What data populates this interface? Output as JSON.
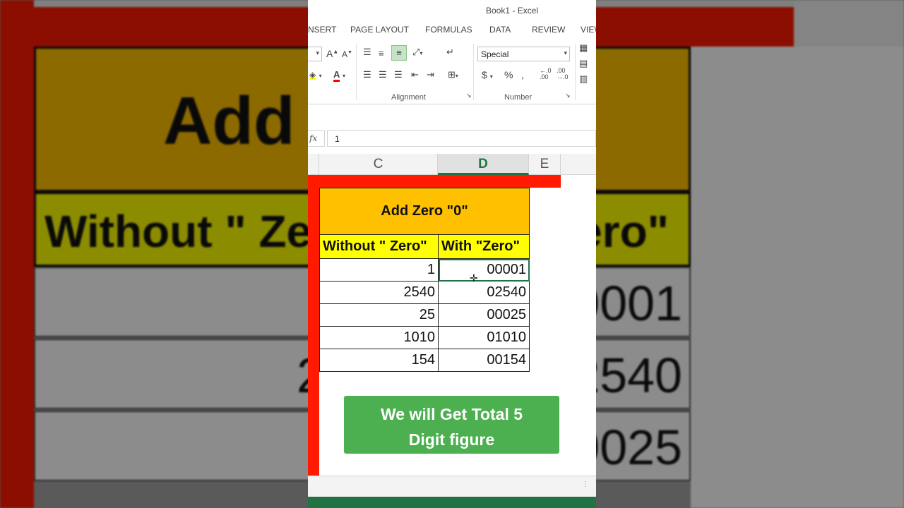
{
  "window": {
    "title": "Book1 - Excel"
  },
  "tabs": [
    "NSERT",
    "PAGE LAYOUT",
    "FORMULAS",
    "DATA",
    "REVIEW",
    "VIEW"
  ],
  "ribbon": {
    "groups": {
      "alignment": "Alignment",
      "number": "Number"
    },
    "number_format": "Special",
    "currency_symbol": "$",
    "percent_symbol": "%",
    "font_grow": "A",
    "font_shrink": "A",
    "font_color_glyph": "A"
  },
  "formula_bar": {
    "fx": "fx",
    "value": "1"
  },
  "columns": [
    {
      "label": "C",
      "selected": false
    },
    {
      "label": "D",
      "selected": true
    },
    {
      "label": "E",
      "selected": false
    }
  ],
  "sheet": {
    "title": "Add Zero \"0\"",
    "headers": [
      "Without \" Zero\"",
      "With \"Zero\""
    ],
    "rows": [
      [
        "1",
        "00001"
      ],
      [
        "2540",
        "02540"
      ],
      [
        "25",
        "00025"
      ],
      [
        "1010",
        "01010"
      ],
      [
        "154",
        "00154"
      ]
    ]
  },
  "callout": {
    "line1": "We will Get Total 5",
    "line2": "Digit figure"
  },
  "backdrop": {
    "title": "Add",
    "header_left": "Without \" Ze",
    "header_right": "ero\"",
    "rows": [
      {
        "l": "",
        "r": "0001"
      },
      {
        "l": "2",
        "r": "2540"
      },
      {
        "l": "",
        "r": "0025"
      }
    ]
  },
  "colors": {
    "excel_green": "#217346",
    "title_fill": "#ffc000",
    "header_fill": "#ffff00",
    "callout_fill": "#4caf50",
    "frame_red": "#ff1a00"
  }
}
